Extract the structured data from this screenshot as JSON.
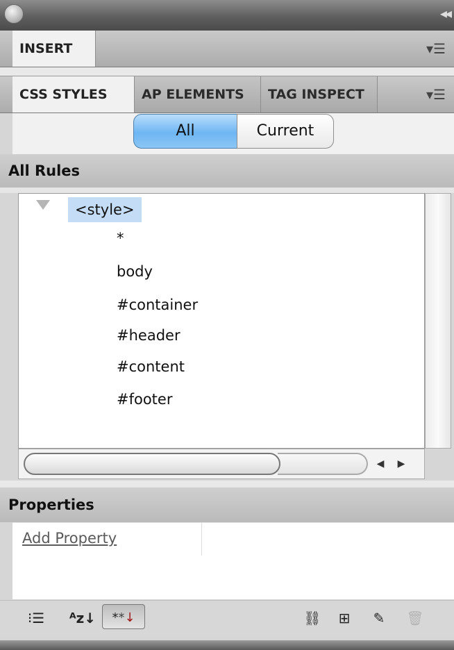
{
  "insert_panel": {
    "tab": "INSERT"
  },
  "css_panel": {
    "tabs": [
      {
        "label": "CSS STYLES"
      },
      {
        "label": "AP ELEMENTS"
      },
      {
        "label": "TAG INSPECT"
      }
    ],
    "mode_buttons": {
      "all": "All",
      "current": "Current",
      "selected": "All"
    }
  },
  "all_rules": {
    "header": "All Rules",
    "root": "<style>",
    "rules": [
      "*",
      "body",
      "#container",
      "#header",
      "#content",
      "#footer"
    ]
  },
  "properties": {
    "header": "Properties",
    "add_property": "Add Property"
  },
  "toolbar_icons": {
    "category_view": "category-view-icon",
    "alpha_view": "alpha-view-icon",
    "set_properties": "show-set-properties-icon",
    "attach": "attach-style-sheet-icon",
    "new_rule": "new-css-rule-icon",
    "edit": "edit-rule-icon",
    "delete": "delete-rule-icon"
  },
  "colors": {
    "selection": "#c5dcf6",
    "active_segment": "#6eb6f3"
  }
}
